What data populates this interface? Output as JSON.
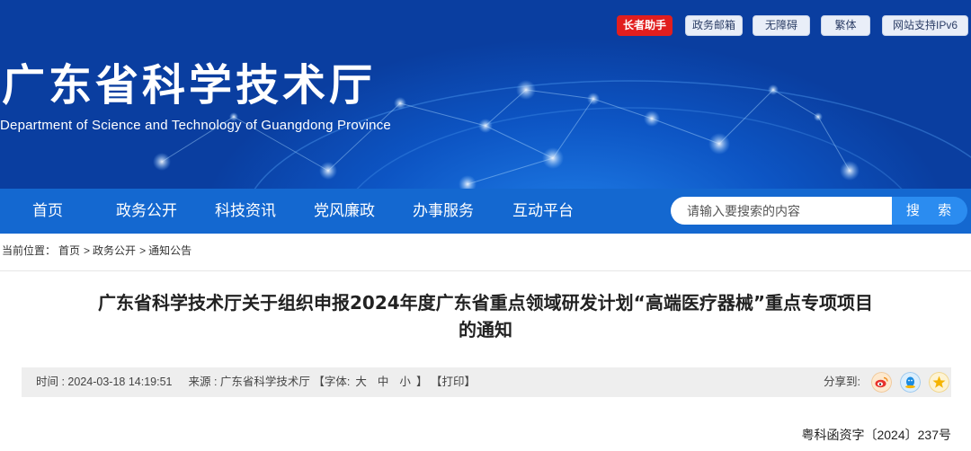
{
  "header": {
    "title": "广东省科学技术厅",
    "subtitle": "Department of Science and Technology of Guangdong Province",
    "top_links": [
      "长者助手",
      "政务邮箱",
      "无障碍",
      "繁体",
      "网站支持IPv6"
    ]
  },
  "nav": {
    "items": [
      "首页",
      "政务公开",
      "科技资讯",
      "党风廉政",
      "办事服务",
      "互动平台"
    ],
    "search_placeholder": "请输入要搜索的内容",
    "search_button": "搜 索"
  },
  "breadcrumb": {
    "label": "当前位置：",
    "items": [
      "首页",
      "政务公开",
      "通知公告"
    ]
  },
  "article": {
    "title_line1": "广东省科学技术厅关于组织申报2024年度广东省重点领域研发计划“高端医疗器械”重点专项项目",
    "title_line2": "的通知",
    "time": "时间 : 2024-03-18 14:19:51",
    "source": "来源 : 广东省科学技术厅",
    "font_size_open": "【字体:",
    "font_sizes": [
      "大",
      "中",
      "小"
    ],
    "font_size_close": "】",
    "print": "【打印】",
    "share_label": "分享到:",
    "share_icons": [
      "weibo-icon",
      "qq-icon",
      "qzone-icon"
    ],
    "doc_number": "粤科函资字〔2024〕237号"
  },
  "colors": {
    "nav_bg": "#1468d0",
    "search_button_bg": "#2b8cf0",
    "elder_helper_bg": "#e11e1e"
  }
}
